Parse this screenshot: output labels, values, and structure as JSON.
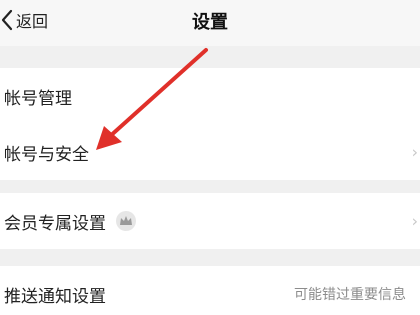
{
  "header": {
    "back_label": "返回",
    "title": "设置"
  },
  "groups": [
    {
      "items": [
        {
          "label": "帐号管理"
        },
        {
          "label": "帐号与安全"
        }
      ]
    },
    {
      "items": [
        {
          "label": "会员专属设置",
          "icon": "crown-icon"
        }
      ]
    },
    {
      "items": [
        {
          "label": "推送通知设置",
          "value": "可能错过重要信息"
        }
      ]
    }
  ],
  "annotation": {
    "color": "#e0302a"
  }
}
